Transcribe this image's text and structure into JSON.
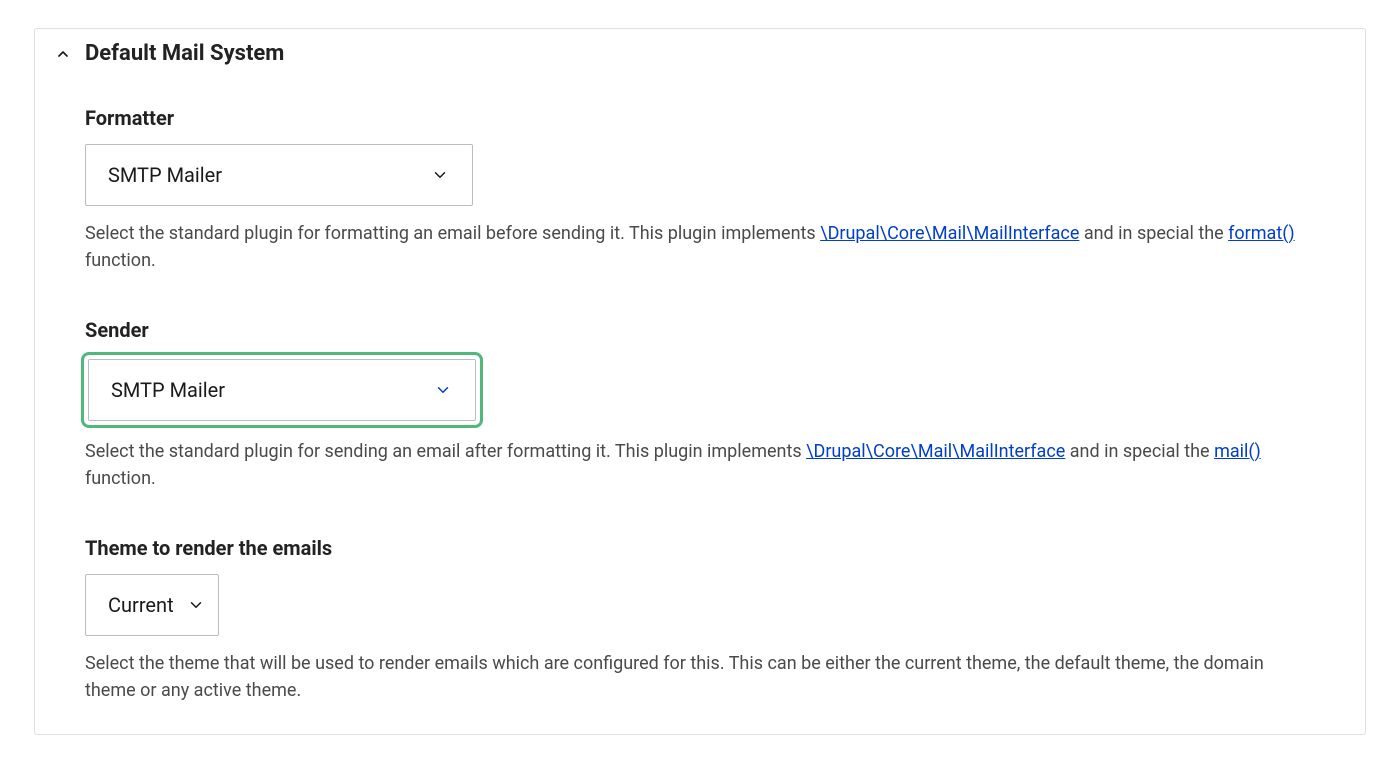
{
  "panel": {
    "title": "Default Mail System"
  },
  "formatter": {
    "label": "Formatter",
    "value": "SMTP Mailer",
    "desc_before_link": "Select the standard plugin for formatting an email before sending it. This plugin implements ",
    "desc_link1": "\\Drupal\\Core\\Mail\\MailInterface",
    "desc_between": " and in special the ",
    "desc_link2": "format()",
    "desc_after": " function."
  },
  "sender": {
    "label": "Sender",
    "value": "SMTP Mailer",
    "desc_before_link": "Select the standard plugin for sending an email after formatting it. This plugin implements ",
    "desc_link1": "\\Drupal\\Core\\Mail\\MailInterface",
    "desc_between": " and in special the ",
    "desc_link2": "mail()",
    "desc_after": " function."
  },
  "theme": {
    "label": "Theme to render the emails",
    "value": "Current",
    "desc": "Select the theme that will be used to render emails which are configured for this. This can be either the current theme, the default theme, the domain theme or any active theme."
  }
}
